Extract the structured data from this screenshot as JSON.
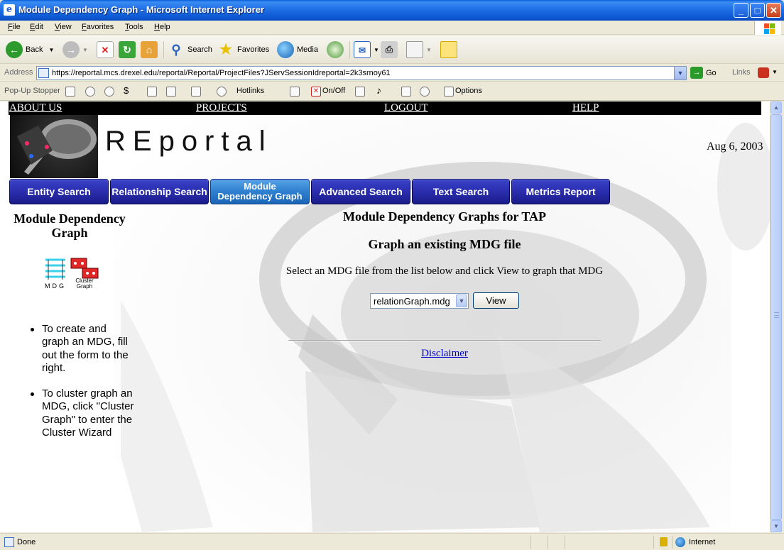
{
  "window": {
    "title": "Module Dependency Graph - Microsoft Internet Explorer",
    "minimize": "_",
    "maximize": "□",
    "close": "✕"
  },
  "menu": [
    "File",
    "Edit",
    "View",
    "Favorites",
    "Tools",
    "Help"
  ],
  "toolbar": {
    "back": "Back",
    "search": "Search",
    "favorites": "Favorites",
    "media": "Media"
  },
  "address": {
    "label": "Address",
    "url": "https://reportal.mcs.drexel.edu/reportal/Reportal/ProjectFiles?JServSessionIdreportal=2k3srnoy61",
    "go": "Go",
    "links": "Links"
  },
  "popupbar": {
    "label": "Pop-Up Stopper",
    "hotlinks": "Hotlinks",
    "onoff": "On/Off",
    "options": "Options"
  },
  "page": {
    "topnav": [
      "ABOUT US",
      "PROJECTS",
      "LOGOUT",
      "HELP"
    ],
    "logo_text": "REportal",
    "date": "Aug 6, 2003",
    "tabs": [
      "Entity Search",
      "Relationship Search",
      "Module Dependency Graph",
      "Advanced Search",
      "Text Search",
      "Metrics Report"
    ],
    "sidebar": {
      "title": "Module Dependency Graph",
      "icon_label_mdg": "MDG",
      "icon_label_cluster": "Cluster Graph",
      "bullets": [
        "To create and graph an MDG, fill out the form to the right.",
        "To cluster graph an MDG, click \"Cluster Graph\" to enter the Cluster Wizard"
      ]
    },
    "main": {
      "heading": "Module Dependency Graphs for TAP",
      "subheading": "Graph an existing MDG file",
      "instruction": "Select an MDG file from the list below and click View to graph that MDG",
      "select_value": "relationGraph.mdg",
      "view_button": "View",
      "disclaimer": "Disclaimer"
    }
  },
  "status": {
    "text": "Done",
    "zone": "Internet"
  }
}
